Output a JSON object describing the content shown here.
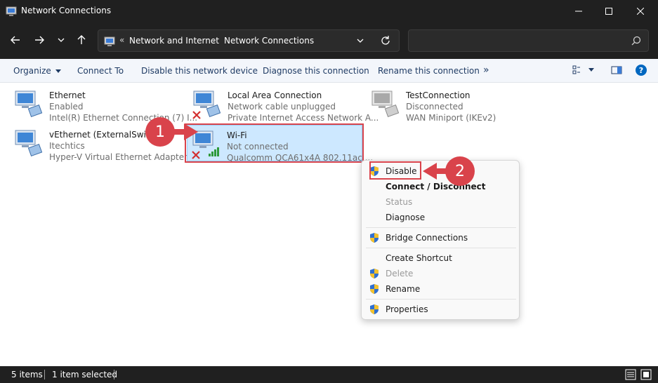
{
  "window": {
    "title": "Network Connections",
    "minimize_icon": "minimize-icon",
    "maximize_icon": "maximize-icon",
    "close_icon": "close-icon"
  },
  "address": {
    "overflow_symbol": "«",
    "crumbs": [
      "Network and Internet",
      "Network Connections"
    ],
    "separator": "›",
    "search_placeholder": ""
  },
  "commands": {
    "organize": "Organize",
    "connect_to": "Connect To",
    "disable_device": "Disable this network device",
    "diagnose": "Diagnose this connection",
    "rename": "Rename this connection",
    "more": "»"
  },
  "connections": [
    {
      "name": "Ethernet",
      "status": "Enabled",
      "device": "Intel(R) Ethernet Connection (7) I...",
      "state": "enabled"
    },
    {
      "name": "Local Area Connection",
      "status": "Network cable unplugged",
      "device": "Private Internet Access Network A...",
      "state": "unplugged"
    },
    {
      "name": "TestConnection",
      "status": "Disconnected",
      "device": "WAN Miniport (IKEv2)",
      "state": "disabled"
    },
    {
      "name": "vEthernet (ExternalSwitch)",
      "status": "Itechtics",
      "device": "Hyper-V Virtual Ethernet Adapter ...",
      "state": "enabled"
    },
    {
      "name": "Wi-Fi",
      "status": "Not connected",
      "device": "Qualcomm QCA61x4A 802.11ac ...",
      "state": "wifi-disconnected"
    }
  ],
  "context_menu": {
    "items": [
      {
        "label": "Disable",
        "shield": true,
        "bold": false,
        "disabled": false
      },
      {
        "label": "Connect / Disconnect",
        "shield": false,
        "bold": true,
        "disabled": false
      },
      {
        "label": "Status",
        "shield": false,
        "bold": false,
        "disabled": true
      },
      {
        "label": "Diagnose",
        "shield": false,
        "bold": false,
        "disabled": false
      },
      {
        "label": "Bridge Connections",
        "shield": true,
        "bold": false,
        "disabled": false
      },
      {
        "label": "Create Shortcut",
        "shield": false,
        "bold": false,
        "disabled": false
      },
      {
        "label": "Delete",
        "shield": true,
        "bold": false,
        "disabled": true
      },
      {
        "label": "Rename",
        "shield": true,
        "bold": false,
        "disabled": false
      },
      {
        "label": "Properties",
        "shield": true,
        "bold": false,
        "disabled": false
      }
    ]
  },
  "callouts": {
    "one": "1",
    "two": "2"
  },
  "status_bar": {
    "items_count": "5 items",
    "selected": "1 item selected"
  },
  "colors": {
    "accent_red": "#d9434b",
    "selection": "#cde8ff",
    "dark_chrome": "#202020",
    "help_blue": "#0067c0"
  }
}
